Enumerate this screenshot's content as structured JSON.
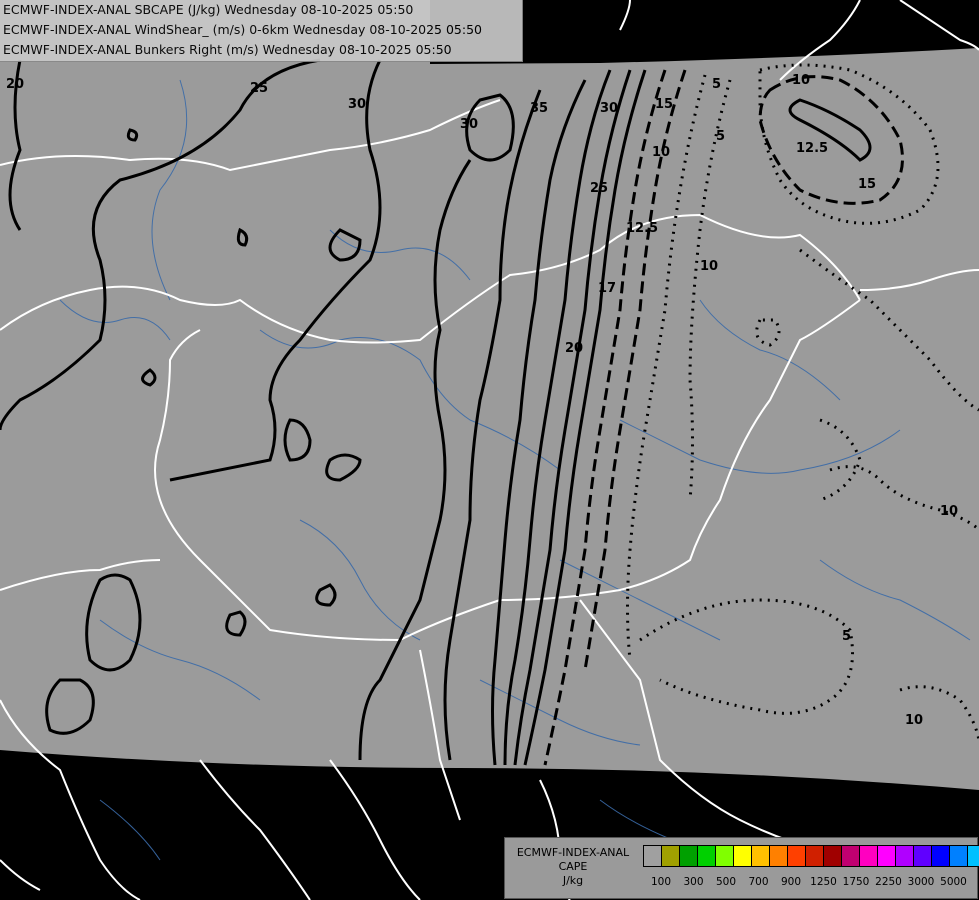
{
  "titles": [
    "ECMWF-INDEX-ANAL SBCAPE (J/kg) Wednesday 08-10-2025 05:50",
    "ECMWF-INDEX-ANAL WindShear_ (m/s) 0-6km Wednesday 08-10-2025 05:50",
    "ECMWF-INDEX-ANAL Bunkers Right (m/s) Wednesday 08-10-2025 05:50"
  ],
  "legend": {
    "line1": "ECMWF-INDEX-ANAL",
    "line2": "CAPE",
    "line3": "J/kg",
    "colors": [
      "#a0a0a0",
      "#a0a000",
      "#00a000",
      "#00d000",
      "#80ff00",
      "#ffff00",
      "#ffc000",
      "#ff8000",
      "#ff4000",
      "#d02000",
      "#a00000",
      "#c00070",
      "#ff00c0",
      "#ff00ff",
      "#b000ff",
      "#6000ff",
      "#0000ff",
      "#0080ff",
      "#00c0ff",
      "#40ffff",
      "#ffffff"
    ],
    "tick_labels": [
      "100",
      "300",
      "500",
      "700",
      "900",
      "1250",
      "1750",
      "2250",
      "3000",
      "5000"
    ]
  },
  "contour_labels": [
    "20",
    "25",
    "30",
    "30",
    "35",
    "30",
    "25",
    "20",
    "17",
    "12.5",
    "10",
    "15",
    "5",
    "5",
    "10",
    "12.5",
    "15",
    "10",
    "10",
    "5",
    "10"
  ]
}
